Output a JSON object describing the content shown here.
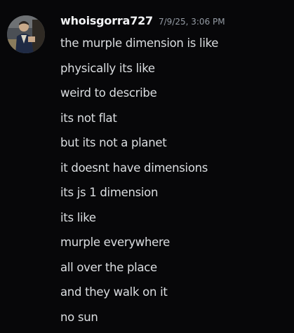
{
  "message": {
    "author": "whoisgorra727",
    "timestamp": "7/9/25, 3:06 PM",
    "avatar_icon": "user-avatar-icon",
    "lines": [
      "the murple dimension is like",
      "physically its like",
      "weird to describe",
      "its not flat",
      "but its not a planet",
      "it doesnt have dimensions",
      "its js 1 dimension",
      "its like",
      "murple everywhere",
      "all over the place",
      "and they walk on it",
      "no sun"
    ]
  },
  "colors": {
    "background": "#070709",
    "username": "#f2f3f5",
    "timestamp": "#949ba4",
    "text": "#dbdee1"
  }
}
